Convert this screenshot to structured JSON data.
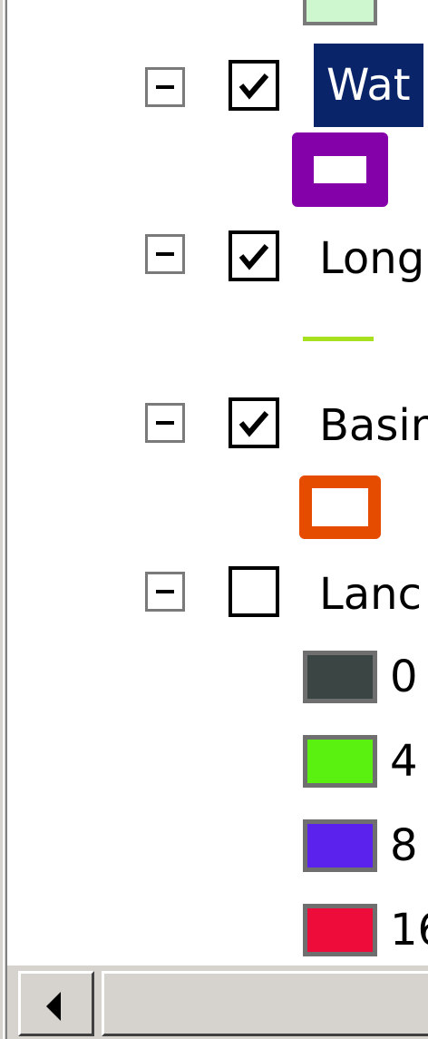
{
  "layers": [
    {
      "label": "Wat",
      "checked": true,
      "selected": true
    },
    {
      "label": "Long",
      "checked": true,
      "selected": false
    },
    {
      "label": "Basin",
      "checked": true,
      "selected": false
    },
    {
      "label": "Lanc",
      "checked": false,
      "selected": false
    }
  ],
  "legend_classes": [
    {
      "label": "0",
      "color": "#3a4544"
    },
    {
      "label": "4",
      "color": "#5af00f"
    },
    {
      "label": "8",
      "color": "#5b22ee"
    },
    {
      "label": "16",
      "color": "#ee0c3a"
    }
  ],
  "symbols": {
    "top_fill": "#cff7cf",
    "water_outline": "#8400a8",
    "long_line": "#a6e01f",
    "basin_outline": "#e64c00"
  },
  "scrollbar": {
    "left_arrow_icon": "triangle-left-icon"
  }
}
